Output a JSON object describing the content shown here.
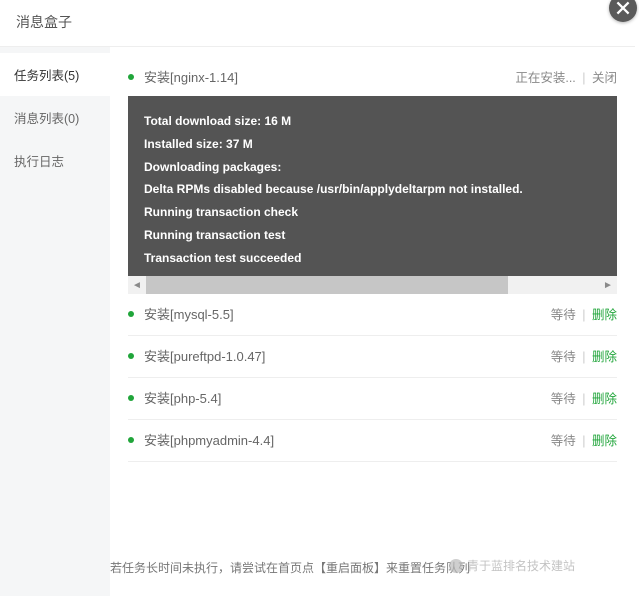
{
  "header": {
    "title": "消息盒子"
  },
  "sidebar": {
    "items": [
      {
        "label": "任务列表(5)"
      },
      {
        "label": "消息列表(0)"
      },
      {
        "label": "执行日志"
      }
    ]
  },
  "tasks": {
    "active": {
      "label": "安装[nginx-1.14]",
      "status": "正在安装...",
      "close_label": "关闭"
    },
    "queue": [
      {
        "label": "安装[mysql-5.5]",
        "status": "等待",
        "del": "删除"
      },
      {
        "label": "安装[pureftpd-1.0.47]",
        "status": "等待",
        "del": "删除"
      },
      {
        "label": "安装[php-5.4]",
        "status": "等待",
        "del": "删除"
      },
      {
        "label": "安装[phpmyadmin-4.4]",
        "status": "等待",
        "del": "删除"
      }
    ]
  },
  "console_lines": [
    "Total download size: 16 M",
    "Installed size: 37 M",
    "Downloading packages:",
    "Delta RPMs disabled because /usr/bin/applydeltarpm not installed.",
    "Running transaction check",
    "Running transaction test",
    "Transaction test succeeded"
  ],
  "footer": {
    "note": "若任务长时间未执行，请尝试在首页点【重启面板】来重置任务队列"
  },
  "watermark": {
    "text": "青于蓝排名技术建站"
  }
}
